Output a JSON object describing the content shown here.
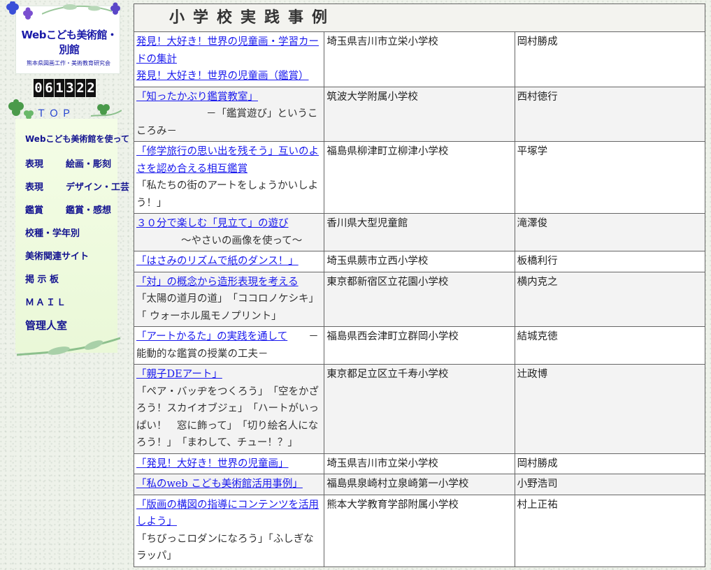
{
  "sidebar": {
    "logo_title": "Webこども美術館・別館",
    "logo_subtitle": "熊本県図画工作・美術教育研究会",
    "counter_digits": [
      "0",
      "6",
      "1",
      "3",
      "2",
      "2"
    ],
    "top_label": "ＴＯＰ",
    "menu": [
      {
        "label": "Webこども美術館を使って"
      },
      {
        "label": "表現"
      },
      {
        "label": "絵画・彫刻"
      },
      {
        "label": "表現"
      },
      {
        "label": "デザイン・工芸"
      },
      {
        "label": "鑑賞"
      },
      {
        "label": "鑑賞・感想"
      },
      {
        "label": "校種・学年別"
      },
      {
        "label": "美術関連サイト"
      },
      {
        "label": "掲 示 板"
      },
      {
        "label": "ＭＡＩＬ"
      },
      {
        "label": "管理人室"
      }
    ]
  },
  "main": {
    "heading": "小学校実践事例",
    "rows": [
      {
        "links": [
          "発見！大好き！世界の児童画・学習カードの集計",
          "発見！大好き！世界の児童画（鑑賞）"
        ],
        "note": "",
        "extra": "",
        "school": "埼玉県吉川市立栄小学校",
        "author": "岡村勝成"
      },
      {
        "links": [
          "「知ったかぶり鑑賞教室」"
        ],
        "note": "－「鑑賞遊び」というこころみ－",
        "extra": "",
        "school": "筑波大学附属小学校",
        "author": "西村徳行"
      },
      {
        "links": [
          "「修学旅行の思い出を残そう」互いのよさを認め合える相互鑑賞"
        ],
        "note": "",
        "extra": "「私たちの街のアートをしょうかいしよう！」",
        "school": "福島県柳津町立柳津小学校",
        "author": "平塚学"
      },
      {
        "links": [
          "３０分で楽しむ「見立て」の遊び"
        ],
        "note": "～やさいの画像を使って～",
        "extra": "",
        "school": "香川県大型児童館",
        "author": "滝澤俊"
      },
      {
        "links": [
          "「はさみのリズムで紙のダンス！」"
        ],
        "note": "",
        "extra": "",
        "school": "埼玉県蕨市立西小学校",
        "author": "板橋利行"
      },
      {
        "links": [
          "「対」の概念から造形表現を考える"
        ],
        "note": "",
        "extra": "「太陽の道月の道」　「ココロノケシキ」　「 ウォーホル風モノプリント」",
        "school": "東京都新宿区立花園小学校",
        "author": "横内克之"
      },
      {
        "links": [
          "「アートかるた」の実践を通して"
        ],
        "note": "－能動的な鑑賞の授業の工夫－",
        "extra": "",
        "school": "福島県西会津町立群岡小学校",
        "author": "結城克徳"
      },
      {
        "links": [
          "「親子DEアート」"
        ],
        "note": "",
        "extra": "「ペア・バッヂをつくろう」　「空をかざろう！スカイオブジェ」　「ハートがいっぱい！　窓に飾って」　「切り絵名人になろう！」　「まわして、チュー！？」",
        "school": "東京都足立区立千寿小学校",
        "author": "辻政博"
      },
      {
        "links": [
          "「発見！大好き！世界の児童画」"
        ],
        "note": "",
        "extra": "",
        "school": "埼玉県吉川市立栄小学校",
        "author": "岡村勝成"
      },
      {
        "links": [
          "「私のweb こども美術館活用事例」"
        ],
        "note": "",
        "extra": "",
        "school": "福島県泉崎村立泉崎第一小学校",
        "author": "小野浩司"
      },
      {
        "links": [
          "「版画の構図の指導にコンテンツを活用しよう」"
        ],
        "note": "",
        "extra": "「ちびっこロダンになろう」「ふしぎなラッパ」",
        "school": "熊本大学教育学部附属小学校",
        "author": "村上正祐"
      }
    ]
  },
  "colors": {
    "link": "#1a1aee",
    "menu_text": "#141490",
    "top_label": "#1f3fd0"
  }
}
